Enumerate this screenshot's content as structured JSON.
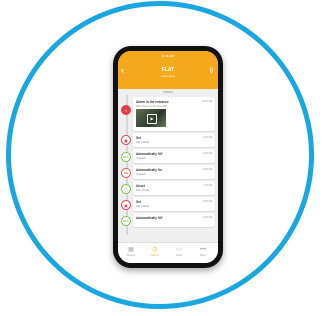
{
  "status_bar": {
    "time": "9:41 AM"
  },
  "header": {
    "title": "FLAT",
    "subtitle": "Automation",
    "back_icon": "chevron-left-icon",
    "filter_icon": "filter-icon"
  },
  "section_label": "TODAY",
  "events": [
    {
      "title": "Alarm in the entrance",
      "subtitle": "Flat • Alarm in the Entrance",
      "time": "10:20 AM",
      "icon": "alarm-icon"
    },
    {
      "title": "Set",
      "subtitle": "Flat • Mode",
      "time": "9:40 AM",
      "icon": "lock-icon"
    },
    {
      "title": "Automatically Off",
      "subtitle": "Irrigation",
      "time": "9:00 AM",
      "icon": "off-icon"
    },
    {
      "title": "Automatically On",
      "subtitle": "Irrigation",
      "time": "8:00 AM",
      "icon": "on-icon"
    },
    {
      "title": "Unset",
      "subtitle": "Flat • Mode",
      "time": "7:20 AM",
      "icon": "unlock-icon"
    },
    {
      "title": "Set",
      "subtitle": "Flat • Mode",
      "time": "6:50 AM",
      "icon": "lock-icon"
    },
    {
      "title": "Automatically Off",
      "subtitle": "",
      "time": "6:00 AM",
      "icon": "off-icon"
    }
  ],
  "tabs": [
    {
      "label": "Devices",
      "icon": "grid-icon"
    },
    {
      "label": "Events",
      "icon": "clock-icon"
    },
    {
      "label": "Video",
      "icon": "camera-icon"
    },
    {
      "label": "More",
      "icon": "more-icon"
    }
  ],
  "colors": {
    "accent": "#f4a81c",
    "ring": "#1aa6e0",
    "alarm": "#e23b4a",
    "ok": "#7cc243"
  }
}
